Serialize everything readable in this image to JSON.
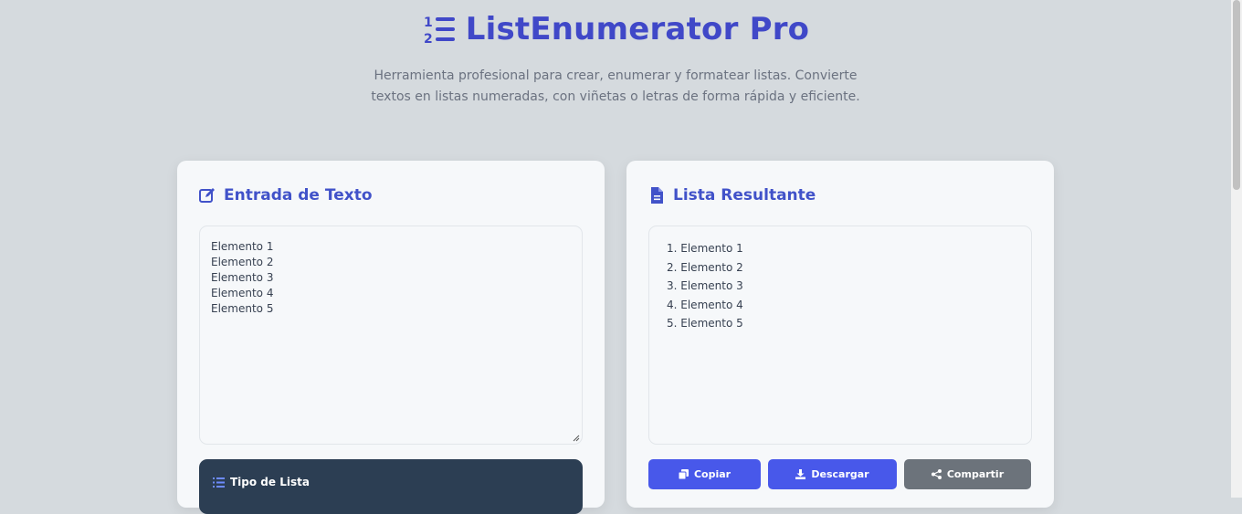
{
  "header": {
    "title": "ListEnumerator Pro",
    "logo_icon": "list-ol-icon",
    "subtitle": "Herramienta profesional para crear, enumerar y formatear listas. Convierte textos en listas numeradas, con viñetas o letras de forma rápida y eficiente."
  },
  "input_card": {
    "title": "Entrada de Texto",
    "icon": "edit-icon",
    "textarea_value": "Elemento 1\nElemento 2\nElemento 3\nElemento 4\nElemento 5"
  },
  "list_type": {
    "title": "Tipo de Lista",
    "icon": "list-icon"
  },
  "output_card": {
    "title": "Lista Resultante",
    "icon": "file-icon",
    "items": [
      {
        "text": "1. Elemento 1"
      },
      {
        "text": "2. Elemento 2"
      },
      {
        "text": "3. Elemento 3"
      },
      {
        "text": "4. Elemento 4"
      },
      {
        "text": "5. Elemento 5"
      }
    ]
  },
  "actions": {
    "copy_label": "Copiar",
    "download_label": "Descargar",
    "share_label": "Compartir"
  },
  "colors": {
    "accent": "#4048c8",
    "primary_button": "#4858ea",
    "secondary_button": "#6c737b",
    "dark_panel": "#2c3e53",
    "background": "#d5dade"
  }
}
